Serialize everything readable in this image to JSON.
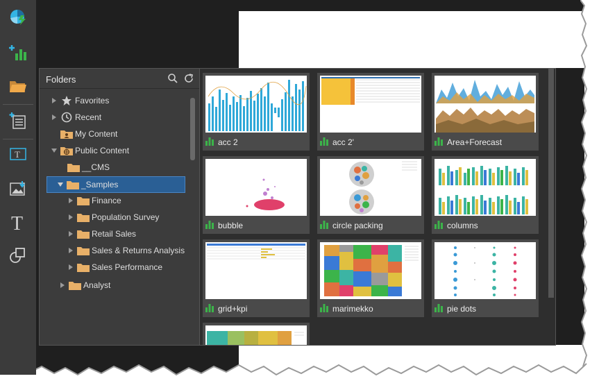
{
  "folders": {
    "title": "Folders",
    "tree": [
      {
        "label": "Favorites",
        "icon": "star-icon",
        "expanded": false
      },
      {
        "label": "Recent",
        "icon": "clock-icon",
        "expanded": false
      },
      {
        "label": "My Content",
        "icon": "user-folder-icon"
      },
      {
        "label": "Public Content",
        "icon": "globe-folder-icon",
        "expanded": true
      },
      {
        "label": "__CMS",
        "icon": "folder-icon"
      },
      {
        "label": "_Samples",
        "icon": "folder-icon",
        "expanded": true,
        "selected": true
      },
      {
        "label": "Finance",
        "icon": "folder-icon"
      },
      {
        "label": "Population Survey",
        "icon": "folder-icon"
      },
      {
        "label": "Retail Sales",
        "icon": "folder-icon"
      },
      {
        "label": "Sales & Returns Analysis",
        "icon": "folder-icon"
      },
      {
        "label": "Sales Performance",
        "icon": "folder-icon"
      },
      {
        "label": "Analyst",
        "icon": "folder-icon"
      }
    ]
  },
  "cards": [
    {
      "label": "acc 2",
      "thumb": "bar-chart-thumb"
    },
    {
      "label": "acc 2'",
      "thumb": "table-thumb"
    },
    {
      "label": "Area+Forecast",
      "thumb": "area-chart-thumb"
    },
    {
      "label": "bubble",
      "thumb": "bubble-thumb"
    },
    {
      "label": "circle packing",
      "thumb": "circle-packing-thumb"
    },
    {
      "label": "columns",
      "thumb": "columns-thumb"
    },
    {
      "label": "grid+kpi",
      "thumb": "grid-kpi-thumb"
    },
    {
      "label": "marimekko",
      "thumb": "marimekko-thumb"
    },
    {
      "label": "pie dots",
      "thumb": "pie-dots-thumb"
    },
    {
      "label": "",
      "thumb": "treemap-thumb"
    }
  ],
  "colors": {
    "accent_green": "#3cb44a",
    "selected_blue": "#2a5f95",
    "folder_tan": "#e8b068",
    "toolbar_cyan": "#34b4e4"
  }
}
